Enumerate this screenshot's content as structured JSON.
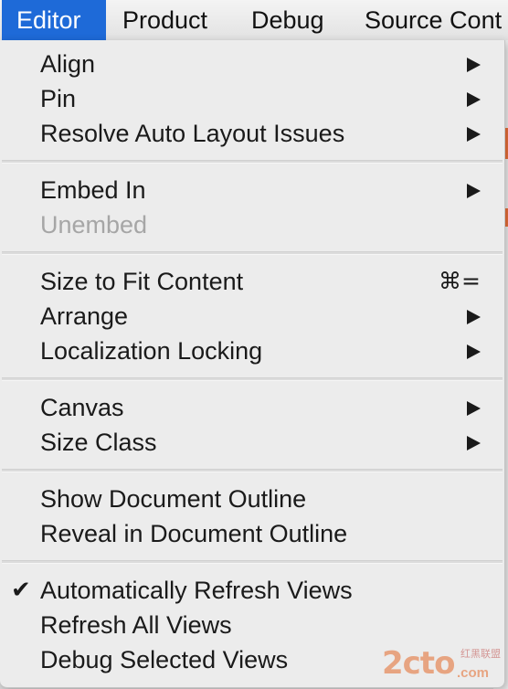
{
  "menubar": {
    "items": [
      {
        "label": "Editor",
        "active": true
      },
      {
        "label": "Product"
      },
      {
        "label": "Debug"
      },
      {
        "label": "Source Cont"
      }
    ]
  },
  "menu": {
    "groups": [
      [
        {
          "label": "Align",
          "submenu": true
        },
        {
          "label": "Pin",
          "submenu": true
        },
        {
          "label": "Resolve Auto Layout Issues",
          "submenu": true
        }
      ],
      [
        {
          "label": "Embed In",
          "submenu": true
        },
        {
          "label": "Unembed",
          "disabled": true
        }
      ],
      [
        {
          "label": "Size to Fit Content",
          "shortcut": "⌘="
        },
        {
          "label": "Arrange",
          "submenu": true
        },
        {
          "label": "Localization Locking",
          "submenu": true
        }
      ],
      [
        {
          "label": "Canvas",
          "submenu": true
        },
        {
          "label": "Size Class",
          "submenu": true
        }
      ],
      [
        {
          "label": "Show Document Outline"
        },
        {
          "label": "Reveal in Document Outline"
        }
      ],
      [
        {
          "label": "Automatically Refresh Views",
          "checked": true,
          "check_mark": "✔"
        },
        {
          "label": "Refresh All Views"
        },
        {
          "label": "Debug Selected Views"
        }
      ]
    ]
  },
  "watermark": {
    "main": "2cto",
    "sub": "红黑联盟",
    "domain": ".com"
  },
  "colors": {
    "accent": "#1e6ad8",
    "disabled_text": "#a6a6a6",
    "menu_bg": "#ececec"
  }
}
